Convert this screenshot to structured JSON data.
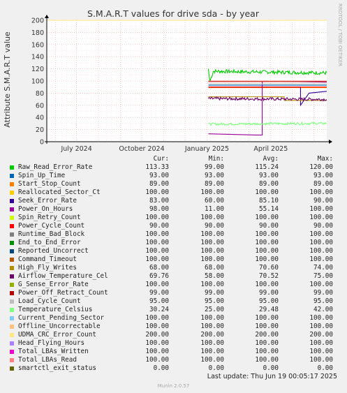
{
  "title": "S.M.A.R.T values for drive sda - by year",
  "side_text": "RRDTOOL / TOBI OETIKER",
  "ylabel": "Attribute S.M.A.R.T value",
  "footer": {
    "last_update": "Last update: Thu Jun 19 00:05:17 2025",
    "munin": "Munin 2.0.57"
  },
  "legend_header": {
    "cur": "Cur:",
    "min": "Min:",
    "avg": "Avg:",
    "max": "Max:"
  },
  "legend": [
    {
      "name": "Raw_Read_Error_Rate",
      "color": "#00cc00",
      "cur": "113.33",
      "min": "99.00",
      "avg": "115.24",
      "max": "120.00"
    },
    {
      "name": "Spin_Up_Time",
      "color": "#0066b3",
      "cur": "93.00",
      "min": "93.00",
      "avg": "93.00",
      "max": "93.00"
    },
    {
      "name": "Start_Stop_Count",
      "color": "#ff8000",
      "cur": "89.00",
      "min": "89.00",
      "avg": "89.00",
      "max": "89.00"
    },
    {
      "name": "Reallocated_Sector_Ct",
      "color": "#ffcc00",
      "cur": "100.00",
      "min": "100.00",
      "avg": "100.00",
      "max": "100.00"
    },
    {
      "name": "Seek_Error_Rate",
      "color": "#330099",
      "cur": "83.00",
      "min": "60.00",
      "avg": "85.10",
      "max": "90.00"
    },
    {
      "name": "Power_On_Hours",
      "color": "#990099",
      "cur": "98.00",
      "min": "11.00",
      "avg": "55.14",
      "max": "100.00"
    },
    {
      "name": "Spin_Retry_Count",
      "color": "#ccff00",
      "cur": "100.00",
      "min": "100.00",
      "avg": "100.00",
      "max": "100.00"
    },
    {
      "name": "Power_Cycle_Count",
      "color": "#ff0000",
      "cur": "90.00",
      "min": "90.00",
      "avg": "90.00",
      "max": "90.00"
    },
    {
      "name": "Runtime_Bad_Block",
      "color": "#808080",
      "cur": "100.00",
      "min": "100.00",
      "avg": "100.00",
      "max": "100.00"
    },
    {
      "name": "End_to_End_Error",
      "color": "#008f00",
      "cur": "100.00",
      "min": "100.00",
      "avg": "100.00",
      "max": "100.00"
    },
    {
      "name": "Reported_Uncorrect",
      "color": "#00487d",
      "cur": "100.00",
      "min": "100.00",
      "avg": "100.00",
      "max": "100.00"
    },
    {
      "name": "Command_Timeout",
      "color": "#b35a00",
      "cur": "100.00",
      "min": "100.00",
      "avg": "100.00",
      "max": "100.00"
    },
    {
      "name": "High_Fly_Writes",
      "color": "#b38f00",
      "cur": "68.00",
      "min": "68.00",
      "avg": "70.60",
      "max": "74.00"
    },
    {
      "name": "Airflow_Temperature_Cel",
      "color": "#6b006b",
      "cur": "69.76",
      "min": "58.00",
      "avg": "70.52",
      "max": "75.00"
    },
    {
      "name": "G_Sense_Error_Rate",
      "color": "#8fb300",
      "cur": "100.00",
      "min": "100.00",
      "avg": "100.00",
      "max": "100.00"
    },
    {
      "name": "Power_Off_Retract_Count",
      "color": "#b30000",
      "cur": "99.00",
      "min": "99.00",
      "avg": "99.00",
      "max": "99.00"
    },
    {
      "name": "Load_Cycle_Count",
      "color": "#bebebe",
      "cur": "95.00",
      "min": "95.00",
      "avg": "95.00",
      "max": "95.00"
    },
    {
      "name": "Temperature_Celsius",
      "color": "#80ff80",
      "cur": "30.24",
      "min": "25.00",
      "avg": "29.48",
      "max": "42.00"
    },
    {
      "name": "Current_Pending_Sector",
      "color": "#80c9ff",
      "cur": "100.00",
      "min": "100.00",
      "avg": "100.00",
      "max": "100.00"
    },
    {
      "name": "Offline_Uncorrectable",
      "color": "#ffc080",
      "cur": "100.00",
      "min": "100.00",
      "avg": "100.00",
      "max": "100.00"
    },
    {
      "name": "UDMA_CRC_Error_Count",
      "color": "#ffe680",
      "cur": "200.00",
      "min": "200.00",
      "avg": "200.00",
      "max": "200.00"
    },
    {
      "name": "Head_Flying_Hours",
      "color": "#aa80ff",
      "cur": "100.00",
      "min": "100.00",
      "avg": "100.00",
      "max": "100.00"
    },
    {
      "name": "Total_LBAs_Written",
      "color": "#ee00cc",
      "cur": "100.00",
      "min": "100.00",
      "avg": "100.00",
      "max": "100.00"
    },
    {
      "name": "Total_LBAs_Read",
      "color": "#ff8080",
      "cur": "100.00",
      "min": "100.00",
      "avg": "100.00",
      "max": "100.00"
    },
    {
      "name": "smartctl_exit_status",
      "color": "#666600",
      "cur": "0.00",
      "min": "0.00",
      "avg": "0.00",
      "max": "0.00"
    }
  ],
  "chart_data": {
    "type": "line",
    "title": "S.M.A.R.T values for drive sda - by year",
    "ylabel": "Attribute S.M.A.R.T value",
    "ylim": [
      0,
      200
    ],
    "yticks": [
      0,
      20,
      40,
      60,
      80,
      100,
      120,
      140,
      160,
      180,
      200
    ],
    "x_range": [
      "2024-05-20",
      "2025-06-19"
    ],
    "data_start": "2025-01-03",
    "xticks": [
      {
        "label": "July 2024",
        "date": "2024-07-01"
      },
      {
        "label": "October 2024",
        "date": "2024-10-01"
      },
      {
        "label": "January 2025",
        "date": "2025-01-01"
      },
      {
        "label": "April 2025",
        "date": "2025-04-01"
      }
    ],
    "grid": true,
    "legend_placement": "bottom",
    "series": [
      {
        "name": "Raw_Read_Error_Rate",
        "type": "noisy",
        "x": [
          "2025-01-03",
          "2025-01-05",
          "2025-01-10",
          "2025-06-19"
        ],
        "y": [
          120,
          99,
          116,
          113.33
        ],
        "noise": 3
      },
      {
        "name": "Spin_Up_Time",
        "x": [
          "2025-01-03",
          "2025-06-19"
        ],
        "y": [
          93,
          93
        ]
      },
      {
        "name": "Start_Stop_Count",
        "x": [
          "2025-01-03",
          "2025-06-19"
        ],
        "y": [
          89,
          89
        ]
      },
      {
        "name": "Reallocated_Sector_Ct",
        "x": [
          "2025-01-03",
          "2025-06-19"
        ],
        "y": [
          100,
          100
        ]
      },
      {
        "name": "Seek_Error_Rate",
        "x": [
          "2025-01-03",
          "2025-05-13",
          "2025-05-13",
          "2025-05-25",
          "2025-06-19"
        ],
        "y": [
          90,
          90,
          60,
          80,
          83
        ]
      },
      {
        "name": "Power_On_Hours",
        "x": [
          "2025-01-03",
          "2025-03-12",
          "2025-03-12",
          "2025-03-20",
          "2025-03-20",
          "2025-06-19"
        ],
        "y": [
          13,
          11,
          11,
          11,
          100,
          98
        ]
      },
      {
        "name": "Spin_Retry_Count",
        "x": [
          "2025-01-03",
          "2025-06-19"
        ],
        "y": [
          100,
          100
        ]
      },
      {
        "name": "Power_Cycle_Count",
        "x": [
          "2025-01-03",
          "2025-06-19"
        ],
        "y": [
          90,
          90
        ]
      },
      {
        "name": "Runtime_Bad_Block",
        "x": [
          "2025-01-03",
          "2025-06-19"
        ],
        "y": [
          100,
          100
        ]
      },
      {
        "name": "End_to_End_Error",
        "x": [
          "2025-01-03",
          "2025-06-19"
        ],
        "y": [
          100,
          100
        ]
      },
      {
        "name": "Reported_Uncorrect",
        "x": [
          "2025-01-03",
          "2025-06-19"
        ],
        "y": [
          100,
          100
        ]
      },
      {
        "name": "Command_Timeout",
        "x": [
          "2025-01-03",
          "2025-06-19"
        ],
        "y": [
          100,
          100
        ]
      },
      {
        "name": "High_Fly_Writes",
        "x": [
          "2025-01-03",
          "2025-04-20",
          "2025-04-20",
          "2025-06-19"
        ],
        "y": [
          74,
          74,
          68,
          68
        ]
      },
      {
        "name": "Airflow_Temperature_Cel",
        "type": "noisy",
        "x": [
          "2025-01-03",
          "2025-06-19"
        ],
        "y": [
          71,
          69.76
        ],
        "noise": 2.5
      },
      {
        "name": "G_Sense_Error_Rate",
        "x": [
          "2025-01-03",
          "2025-06-19"
        ],
        "y": [
          100,
          100
        ]
      },
      {
        "name": "Power_Off_Retract_Count",
        "x": [
          "2025-01-03",
          "2025-06-19"
        ],
        "y": [
          99,
          99
        ]
      },
      {
        "name": "Load_Cycle_Count",
        "x": [
          "2025-01-03",
          "2025-06-19"
        ],
        "y": [
          95,
          95
        ]
      },
      {
        "name": "Temperature_Celsius",
        "type": "noisy",
        "x": [
          "2025-01-03",
          "2025-06-19"
        ],
        "y": [
          29,
          30.24
        ],
        "noise": 2
      },
      {
        "name": "Current_Pending_Sector",
        "x": [
          "2025-01-03",
          "2025-06-19"
        ],
        "y": [
          100,
          100
        ]
      },
      {
        "name": "Offline_Uncorrectable",
        "x": [
          "2025-01-03",
          "2025-06-19"
        ],
        "y": [
          100,
          100
        ]
      },
      {
        "name": "UDMA_CRC_Error_Count",
        "x": [
          "2024-05-20",
          "2025-06-19"
        ],
        "y": [
          200,
          200
        ]
      },
      {
        "name": "Head_Flying_Hours",
        "x": [
          "2025-01-03",
          "2025-06-19"
        ],
        "y": [
          100,
          100
        ]
      },
      {
        "name": "Total_LBAs_Written",
        "x": [
          "2025-01-03",
          "2025-06-19"
        ],
        "y": [
          100,
          100
        ]
      },
      {
        "name": "Total_LBAs_Read",
        "x": [
          "2025-01-03",
          "2025-06-19"
        ],
        "y": [
          100,
          100
        ]
      },
      {
        "name": "smartctl_exit_status",
        "x": [
          "2024-05-20",
          "2025-06-19"
        ],
        "y": [
          0,
          0
        ]
      }
    ]
  }
}
